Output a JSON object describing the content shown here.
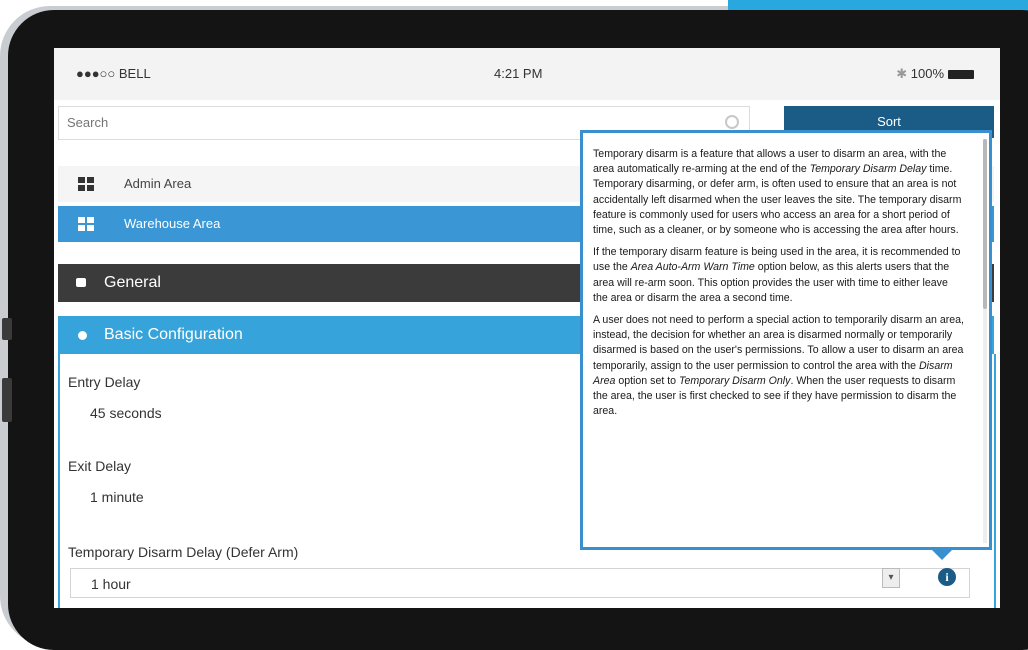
{
  "status_bar": {
    "carrier": "●●●○○ BELL",
    "wifi_icon": "wifi-icon",
    "time": "4:21 PM",
    "bluetooth_icon": "bluetooth-icon",
    "battery": "100%"
  },
  "search": {
    "placeholder": "Search"
  },
  "sort_label": "Sort",
  "areas": [
    {
      "label": "Admin Area"
    },
    {
      "label": "Warehouse Area"
    }
  ],
  "sections": {
    "general": "General",
    "basic": "Basic Configuration"
  },
  "fields": {
    "entry_delay": {
      "label": "Entry Delay",
      "value": "45 seconds"
    },
    "exit_delay": {
      "label": "Exit Delay",
      "value": "1 minute"
    },
    "temp_disarm": {
      "label": "Temporary Disarm Delay (Defer Arm)",
      "value": "1 hour"
    }
  },
  "popup": {
    "p1": [
      "Temporary disarm is a feature that allows a user to disarm an area, with the area automatically re-arming at the end of the ",
      "Temporary Disarm Delay",
      " time. Temporary disarming, or defer arm, is often used to ensure that an area is not accidentally left disarmed when the user leaves the site. The temporary disarm feature is commonly used for users who access an area for a short period of time, such as a cleaner, or by someone who is accessing the area after hours."
    ],
    "p2": [
      "If the temporary disarm feature is being used in the area, it is recommended to use the ",
      "Area Auto-Arm Warn Time",
      " option below, as this alerts users that the area will re-arm soon. This option provides the user with time to either leave the area or disarm the area a second time."
    ],
    "p3": [
      "A user does not need to perform a special action to temporarily disarm an area, instead, the decision for whether an area is disarmed normally or temporarily disarmed is based on the user's permissions. To allow a user to disarm an area temporarily, assign to the user permission to control the area with the ",
      "Disarm Area",
      " option set to ",
      "Temporary Disarm Only",
      ". When the user requests to disarm the area, the user is first checked to see if they have permission to disarm the area."
    ]
  },
  "colors": {
    "accent": "#37a3db",
    "selected_row": "#3a96d5",
    "sort_button": "#1b5c86",
    "general_header": "#3b3b3b"
  }
}
